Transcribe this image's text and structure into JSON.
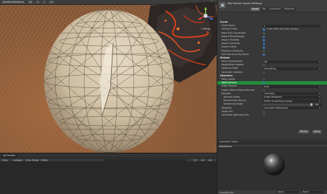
{
  "scene": {
    "toolbar": {
      "shading_mode": "Shaded Wireframe",
      "mode_2d": "2D"
    },
    "view_label": "< Persp"
  },
  "inspector": {
    "title": "Red Sphere Import Settings",
    "tabs": [
      {
        "label": "Model"
      },
      {
        "label": "Rig"
      },
      {
        "label": "Animation"
      },
      {
        "label": "Materials"
      }
    ],
    "rows": [
      {
        "label": "Scene",
        "kind": "header"
      },
      {
        "label": "Scale Factor",
        "kind": "value",
        "value": "1"
      },
      {
        "label": "Convert Units",
        "kind": "check",
        "checked": true,
        "value": "1 unit (File) to 0.01m (Unity)"
      },
      {
        "label": "Bake Axis Conversion",
        "kind": "check",
        "checked": false
      },
      {
        "label": "Import BlendShapes",
        "kind": "check",
        "checked": true
      },
      {
        "label": "Import Visibility",
        "kind": "check",
        "checked": true
      },
      {
        "label": "Import Cameras",
        "kind": "check",
        "checked": true
      },
      {
        "label": "Import Lights",
        "kind": "check",
        "checked": true
      },
      {
        "label": "Preserve Hierarchy",
        "kind": "check",
        "checked": false
      },
      {
        "label": "Sort Hierarchy By Name",
        "kind": "check",
        "checked": true
      },
      {
        "label": "Meshes",
        "kind": "header"
      },
      {
        "label": "Mesh Compression",
        "kind": "dropdown",
        "value": "Off"
      },
      {
        "label": "Read/Write Enabled",
        "kind": "check",
        "checked": false
      },
      {
        "label": "Optimize Mesh",
        "kind": "dropdown",
        "value": "Everything"
      },
      {
        "label": "Generate Colliders",
        "kind": "check",
        "checked": false
      },
      {
        "label": "Geometry",
        "kind": "header"
      },
      {
        "label": "Keep Quads",
        "kind": "check",
        "checked": false
      },
      {
        "label": "Weld Vertices",
        "kind": "check",
        "checked": true,
        "highlight": true
      },
      {
        "label": "Index Format",
        "kind": "dropdown",
        "value": "Auto"
      },
      {
        "label": "Legacy Blend Shape Normals",
        "kind": "check",
        "checked": false
      },
      {
        "label": "Normals",
        "kind": "dropdown",
        "value": "Calculate"
      },
      {
        "label": "Normals Mode",
        "kind": "dropdown",
        "value": "Angle Weighted",
        "sub": true
      },
      {
        "label": "Smoothness Source",
        "kind": "dropdown",
        "value": "Prefer Smoothing Groups",
        "sub": true
      },
      {
        "label": "Smoothing Angle",
        "kind": "slider",
        "value": "180",
        "fraction": 1.0,
        "sub": true
      },
      {
        "label": "Tangents",
        "kind": "dropdown",
        "value": "Calculate Mikktspace"
      },
      {
        "label": "Swap UVs",
        "kind": "check",
        "checked": false
      },
      {
        "label": "Generate Lightmap UVs",
        "kind": "check",
        "checked": false
      }
    ],
    "revert_label": "Revert",
    "apply_label": "Apply"
  },
  "preview": {
    "imported_label": "Imported Object",
    "name": "RedSphere",
    "assetbundle_label": "AssetBundle",
    "assetbundle_value": "None",
    "variant_value": "None"
  },
  "console": {
    "tab_label": "Console",
    "clear": "Clear",
    "collapse": "Collapse",
    "error_pause": "Error Pause",
    "editor": "Editor",
    "info_count": "0",
    "warn_count": "0",
    "error_count": "0"
  },
  "colors": {
    "highlight": "#1f8f3a",
    "checkbox_on": "#3d6fb0",
    "terrain": "#8d5b37",
    "lava": "#d9401a"
  }
}
